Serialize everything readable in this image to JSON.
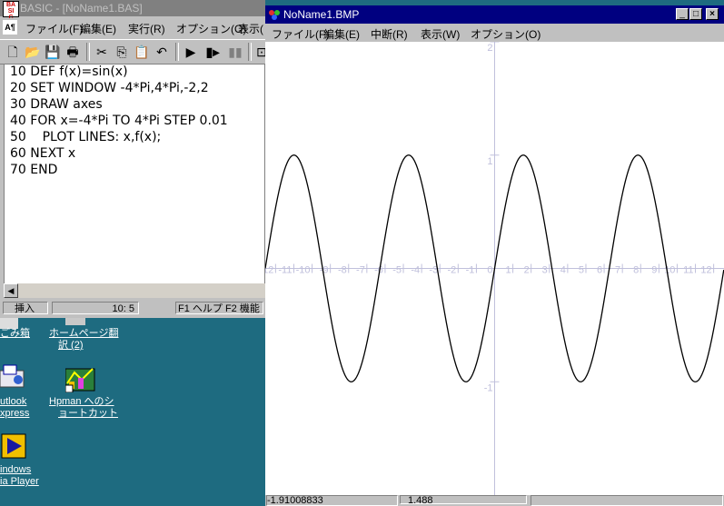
{
  "basic_window": {
    "title": "BASIC - [NoName1.BAS]",
    "menu": [
      "ファイル(F)",
      "編集(E)",
      "実行(R)",
      "オプション(O)",
      "表示("
    ],
    "code_lines": [
      "10 DEF f(x)=sin(x)",
      "20 SET WINDOW -4*Pi,4*Pi,-2,2",
      "30 DRAW axes",
      "40 FOR x=-4*Pi TO 4*Pi STEP 0.01",
      "50    PLOT LINES: x,f(x);",
      "60 NEXT x",
      "70 END"
    ],
    "status": {
      "mode": "挿入",
      "position": "10:  5",
      "help": "F1 ヘルプ  F2 機能"
    }
  },
  "desktop_icons": [
    {
      "label_line1": "ごみ箱",
      "label_line2": ""
    },
    {
      "label_line1": "ホームページ翻",
      "label_line2": "訳 (2)"
    },
    {
      "label_line1": "utlook",
      "label_line2": "xpress"
    },
    {
      "label_line1": "Hpman へのシ",
      "label_line2": "ョートカット"
    },
    {
      "label_line1": "indows",
      "label_line2": "ia Player"
    }
  ],
  "bmp_window": {
    "title": "NoName1.BMP",
    "menu": [
      "ファイル(F)",
      "編集(E)",
      "中断(R)",
      "表示(W)",
      "オプション(O)"
    ],
    "status": {
      "x_value": "-1.91008833",
      "y_value": "1.488"
    }
  },
  "colors": {
    "desktop": "#1e6b80",
    "active_title": "#000080",
    "inactive_title": "#808080",
    "axis": "#c0c0dc",
    "face": "#c0c0c0"
  },
  "chart_data": {
    "type": "line",
    "function": "sin(x)",
    "xlim": [
      -12.566,
      12.566
    ],
    "ylim": [
      -2,
      2
    ],
    "x_tick_labels": [
      "-12",
      "-11",
      "-10",
      "-9",
      "-8",
      "-7",
      "-6",
      "-5",
      "-4",
      "-3",
      "-2",
      "-1",
      "0",
      "1",
      "2",
      "3",
      "4",
      "5",
      "6",
      "7",
      "8",
      "9",
      "10",
      "11",
      "12"
    ],
    "y_tick_labels": [
      "2",
      "1",
      "-1"
    ],
    "series": [
      {
        "values_note_sin": [
          0,
          1,
          0,
          -1,
          0,
          1,
          0,
          -1,
          0
        ]
      }
    ],
    "x_sample": [
      -12.566,
      -9.425,
      -6.283,
      -3.142,
      0,
      3.142,
      6.283,
      9.425,
      12.566
    ],
    "y_sample": [
      0,
      0,
      0,
      0,
      0,
      0,
      0,
      0,
      0
    ]
  }
}
